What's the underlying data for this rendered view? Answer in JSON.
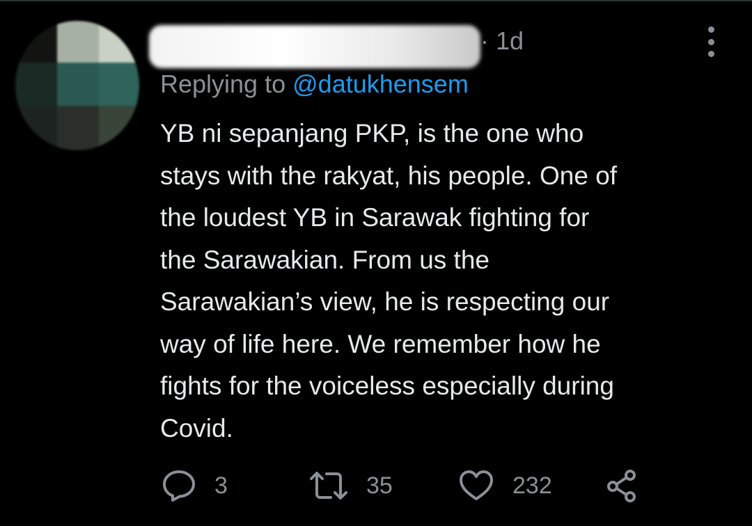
{
  "tweet": {
    "timestamp": "· 1d",
    "replying_prefix": "Replying to",
    "replying_handle": "@datukhensem",
    "text_lines": [
      "YB ni sepanjang PKP, is the one who",
      "stays with the rakyat, his people. One of",
      "the loudest YB in Sarawak fighting for",
      "the Sarawakian. From us the",
      "Sarawakian’s view, he is respecting our",
      "way of life here. We remember how he",
      "fights for the voiceless especially during",
      "Covid."
    ]
  },
  "actions": {
    "reply_count": "3",
    "retweet_count": "35",
    "like_count": "232"
  },
  "icons": {
    "reply": "reply-icon",
    "retweet": "retweet-icon",
    "like": "heart-icon",
    "share": "share-icon",
    "more": "more-options-icon"
  },
  "colors": {
    "background": "#000000",
    "text": "#e7e9ea",
    "secondary": "#8b9096",
    "link": "#1d9bf0"
  }
}
